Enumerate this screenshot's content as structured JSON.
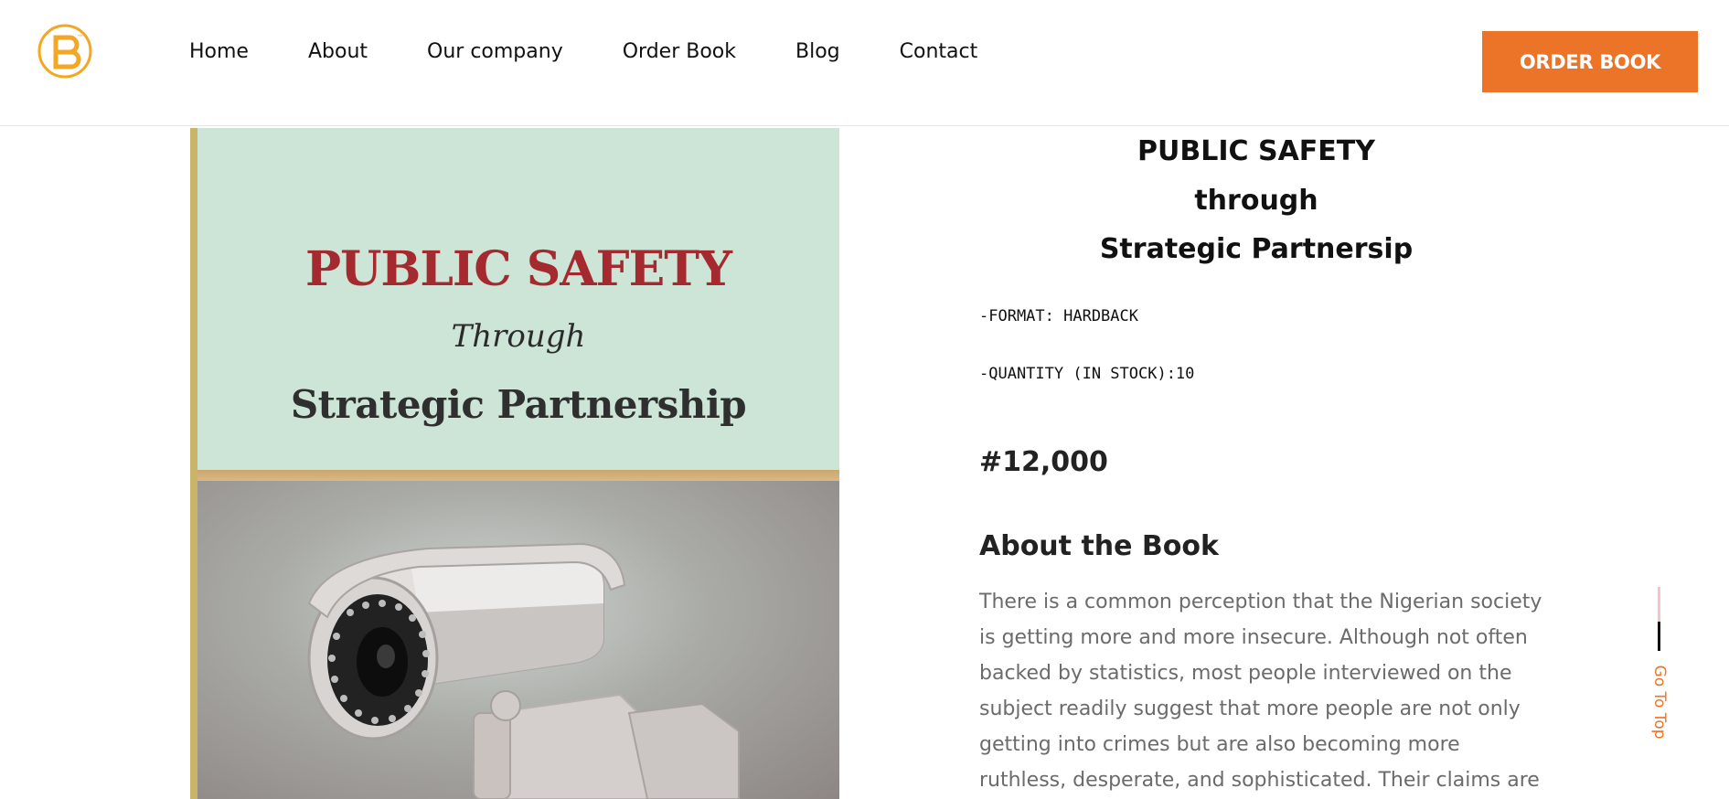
{
  "header": {
    "logo_letter": "B",
    "logo_tm": "™",
    "nav": [
      "Home",
      "About",
      "Our company",
      "Order Book",
      "Blog",
      "Contact"
    ],
    "order_button": "ORDER BOOK"
  },
  "cover": {
    "line1": "PUBLIC SAFETY",
    "line2": "Through",
    "line3": "Strategic Partnership"
  },
  "book": {
    "title_line1": "PUBLIC SAFETY",
    "title_line2": "through",
    "title_line3": "Strategic Partnersip",
    "format": "-FORMAT: HARDBACK",
    "quantity": "-QUANTITY (IN STOCK):10",
    "price": "#12,000"
  },
  "about": {
    "heading": "About the Book",
    "lines": [
      "There is a common perception that the Nigerian society",
      "is getting more and more insecure. Although not often",
      "backed by statistics, most people interviewed on the",
      "subject readily suggest that more people are not only",
      "getting into crimes but are also becoming more",
      "ruthless, desperate, and sophisticated. Their claims are"
    ]
  },
  "go_to_top": "Go To Top",
  "colors": {
    "accent": "#ec7428",
    "logo": "#f5a623",
    "cover_top": "#cce5d6",
    "cover_title": "#a52a2f"
  }
}
